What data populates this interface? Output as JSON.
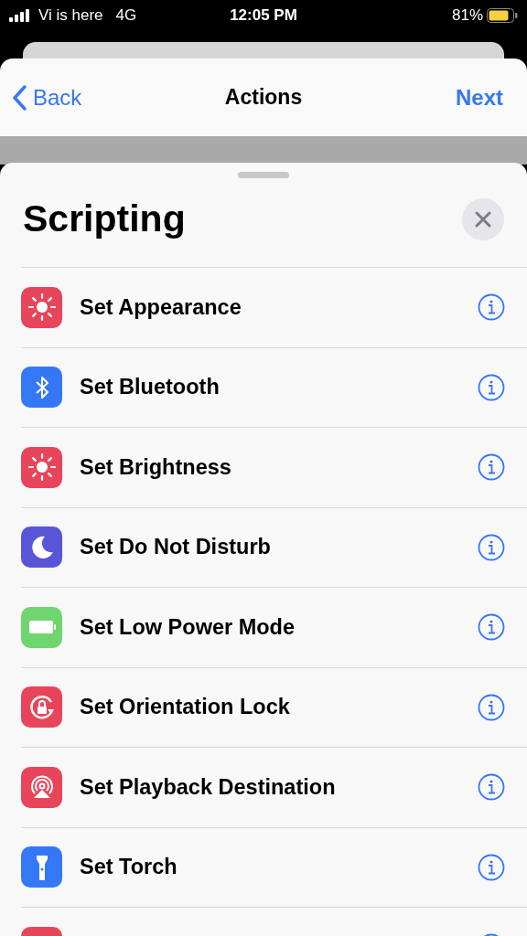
{
  "status_bar": {
    "carrier": "Vi is here",
    "network": "4G",
    "time": "12:05 PM",
    "battery_percent": "81%"
  },
  "nav": {
    "back": "Back",
    "title": "Actions",
    "next": "Next"
  },
  "sheet": {
    "title": "Scripting",
    "items": [
      {
        "label": "Set Appearance",
        "kind": "sun",
        "color": "#e9455a"
      },
      {
        "label": "Set Bluetooth",
        "kind": "bluetooth",
        "color": "#3478f6"
      },
      {
        "label": "Set Brightness",
        "kind": "sun",
        "color": "#e9455a"
      },
      {
        "label": "Set Do Not Disturb",
        "kind": "moon",
        "color": "#5856d6"
      },
      {
        "label": "Set Low Power Mode",
        "kind": "battery",
        "color": "#6fd56f"
      },
      {
        "label": "Set Orientation Lock",
        "kind": "lock",
        "color": "#e9455a"
      },
      {
        "label": "Set Playback Destination",
        "kind": "airplay",
        "color": "#e9455a"
      },
      {
        "label": "Set Torch",
        "kind": "torch",
        "color": "#3478f6"
      },
      {
        "kind": "blank",
        "color": "#e9455a"
      }
    ]
  }
}
